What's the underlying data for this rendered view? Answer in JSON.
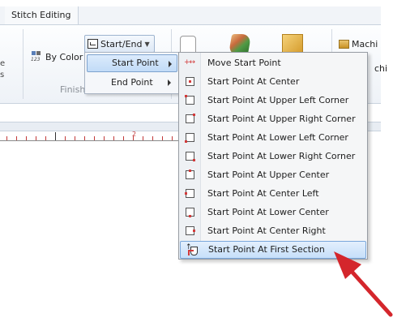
{
  "ribbon": {
    "tab_label": "Stitch Editing",
    "left_cut_text": [
      "e",
      "s"
    ],
    "by_color_icon_text": "123",
    "by_color_label": "By Color",
    "start_end_label": "Start/End",
    "group_label": "Finishing Tools",
    "machine_label": "Machi",
    "machine_label_2": "chi"
  },
  "ruler": {
    "number": "2"
  },
  "submenu": {
    "items": [
      {
        "label": "Start Point",
        "has_submenu": true,
        "highlighted": true
      },
      {
        "label": "End Point",
        "has_submenu": true,
        "highlighted": false
      }
    ]
  },
  "start_point_menu": {
    "items": [
      {
        "label": "Move Start Point",
        "icon": "move-arrows-icon"
      },
      {
        "label": "Start Point At Center",
        "icon": "center-point-icon"
      },
      {
        "label": "Start Point At Upper Left Corner",
        "icon": "upper-left-point-icon"
      },
      {
        "label": "Start Point At Upper Right Corner",
        "icon": "upper-right-point-icon"
      },
      {
        "label": "Start Point At Lower Left Corner",
        "icon": "lower-left-point-icon"
      },
      {
        "label": "Start Point At Lower Right Corner",
        "icon": "lower-right-point-icon"
      },
      {
        "label": "Start Point At Upper Center",
        "icon": "upper-center-point-icon"
      },
      {
        "label": "Start Point At Center Left",
        "icon": "center-left-point-icon"
      },
      {
        "label": "Start Point At Lower Center",
        "icon": "lower-center-point-icon"
      },
      {
        "label": "Start Point At Center Right",
        "icon": "center-right-point-icon"
      },
      {
        "label": "Start Point At First Section",
        "icon": "first-section-point-icon",
        "selected": true
      }
    ]
  },
  "colors": {
    "accent_highlight": "#c6dff9",
    "annotation_arrow": "#d4262c",
    "marker_red": "#d23a3a"
  }
}
